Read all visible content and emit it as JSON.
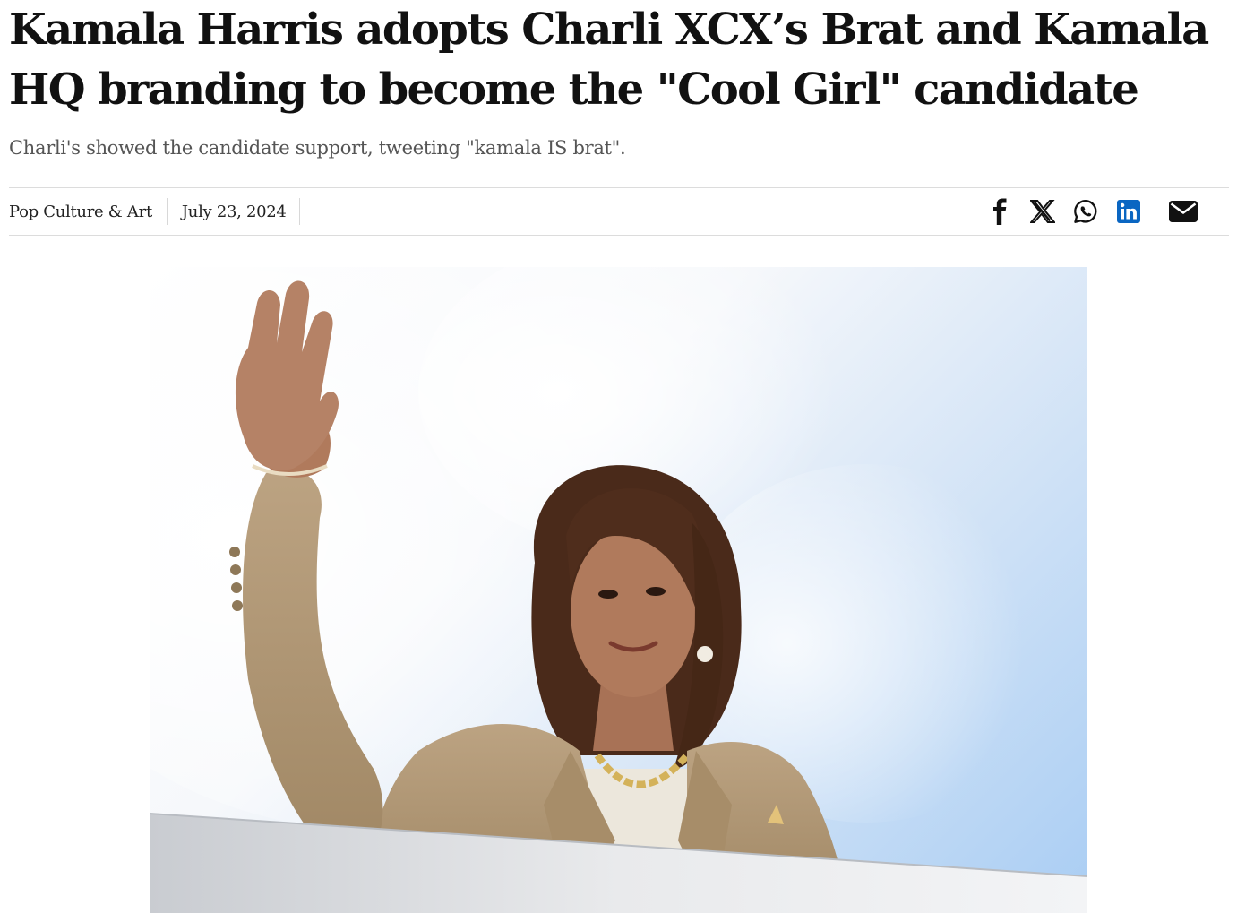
{
  "article": {
    "headline": "Kamala Harris adopts Charli XCX’s Brat and Kamala HQ branding to become the \"Cool Girl\" candidate",
    "dek": "Charli's showed the candidate support, tweeting \"kamala IS brat\".",
    "category": "Pop Culture & Art",
    "date": "July 23, 2024"
  },
  "share": {
    "icons": [
      "facebook-icon",
      "x-icon",
      "whatsapp-icon",
      "linkedin-icon",
      "email-icon"
    ],
    "linkedin_color": "#0a66c2"
  },
  "hero": {
    "icons": [
      "photo-subject-waving"
    ],
    "colors": {
      "sky": "#a9cdf3",
      "jacket": "#b39a78",
      "hair": "#4a2a1a",
      "skin": "#b07a5c"
    }
  }
}
